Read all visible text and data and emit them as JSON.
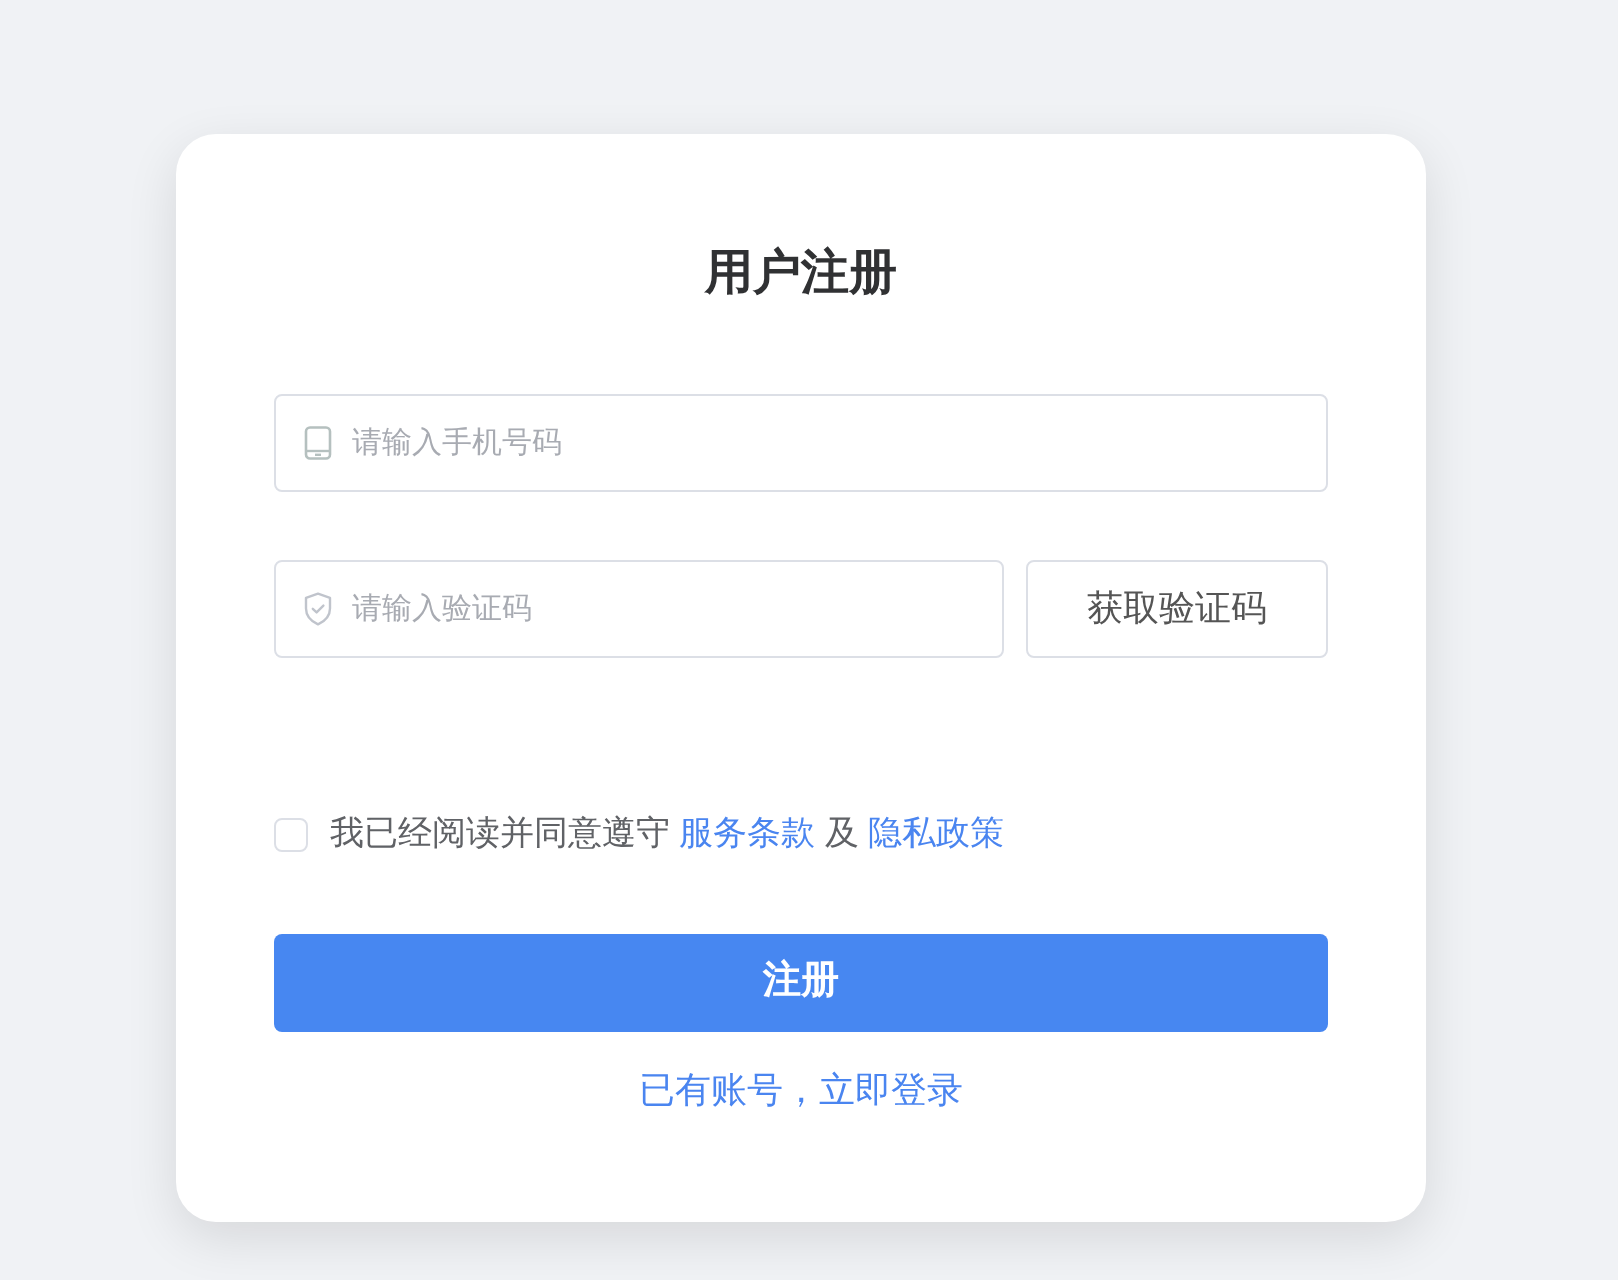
{
  "title": "用户注册",
  "phone_field": {
    "placeholder": "请输入手机号码"
  },
  "code_field": {
    "placeholder": "请输入验证码"
  },
  "get_code_button": "获取验证码",
  "agreement": {
    "checked": false,
    "text": "我已经阅读并同意遵守",
    "terms_link": "服务条款",
    "conjunction": "及",
    "privacy_link": "隐私政策"
  },
  "register_button": "注册",
  "login_link": "已有账号，立即登录"
}
